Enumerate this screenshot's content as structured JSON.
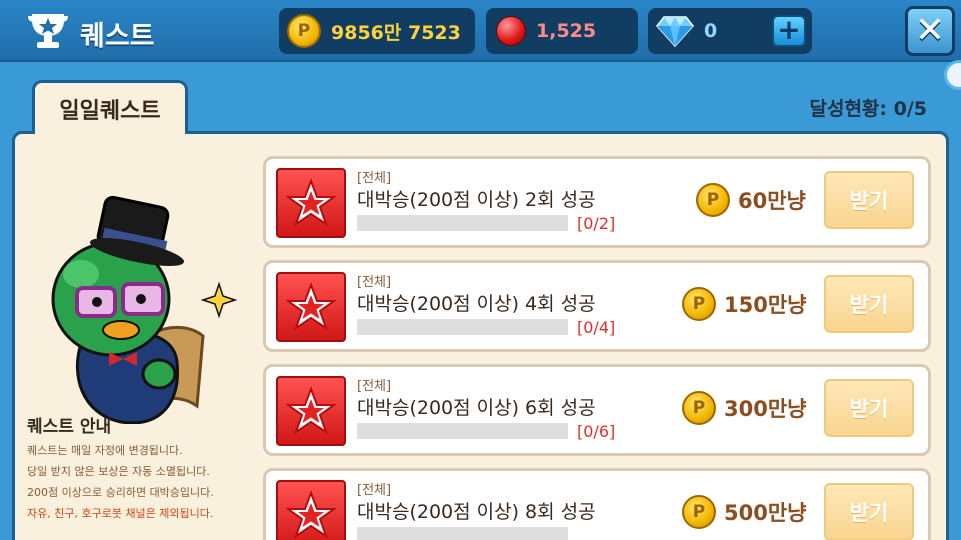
{
  "header": {
    "title": "퀘스트",
    "gold": "9856만 7523",
    "ruby": "1,525",
    "gem": "0",
    "plus_label": "+",
    "close_label": "✕",
    "coin_symbol": "P"
  },
  "tabs": [
    {
      "label": "일일퀘스트",
      "active": true
    }
  ],
  "progress_summary": "달성현황: 0/5",
  "info": {
    "title": "퀘스트 안내",
    "lines": [
      "퀘스트는 매일 자정에 변경됩니다.",
      "당일 받지 않은 보상은 자동 소멸됩니다.",
      "200점 이상으로 승리하면 대박승입니다.",
      "자유, 친구, 호구로봇 채널은 제외됩니다."
    ]
  },
  "quests": [
    {
      "category": "[전체]",
      "title": "대박승(200점 이상) 2회 성공",
      "progress_text": "[0/2]",
      "progress": 0,
      "reward": "60만냥",
      "claim_label": "받기"
    },
    {
      "category": "[전체]",
      "title": "대박승(200점 이상) 4회 성공",
      "progress_text": "[0/4]",
      "progress": 0,
      "reward": "150만냥",
      "claim_label": "받기"
    },
    {
      "category": "[전체]",
      "title": "대박승(200점 이상) 6회 성공",
      "progress_text": "[0/6]",
      "progress": 0,
      "reward": "300만냥",
      "claim_label": "받기"
    },
    {
      "category": "[전체]",
      "title": "대박승(200점 이상) 8회 성공",
      "progress_text": "",
      "progress": 0,
      "reward": "500만냥",
      "claim_label": "받기"
    }
  ],
  "colors": {
    "header_bg": "#2b86c8",
    "panel_bg": "#f9f1de",
    "gold_text": "#ffd13a",
    "ruby_text": "#ff8a8a",
    "gem_text": "#8fd8ff",
    "count_red": "#e0312d",
    "reward_brown": "#8a4e1f"
  }
}
